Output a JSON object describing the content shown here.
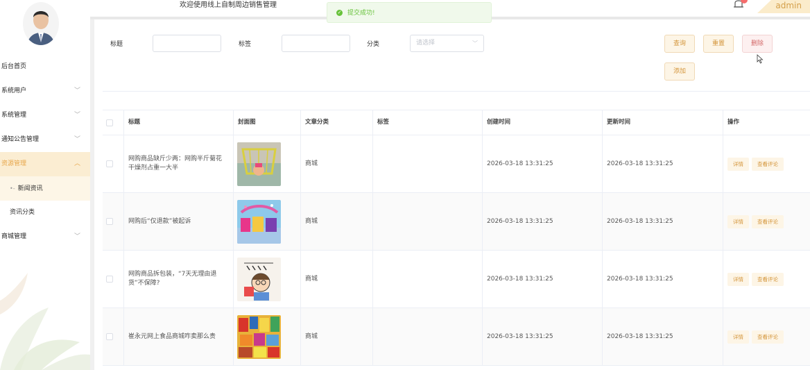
{
  "header": {
    "welcome": "欢迎使用线上自制周边销售管理",
    "username": "admin"
  },
  "toast": {
    "message": "提交成功!"
  },
  "sidebar": {
    "items": [
      {
        "label": "后台首页",
        "has_arrow": false
      },
      {
        "label": "系统用户",
        "has_arrow": true
      },
      {
        "label": "系统管理",
        "has_arrow": true
      },
      {
        "label": "通知公告管理",
        "has_arrow": true
      },
      {
        "label": "资源管理",
        "has_arrow": true,
        "expanded": true
      },
      {
        "label": "新闻资讯",
        "sub": true,
        "selected": true
      },
      {
        "label": "资讯分类",
        "sub": true
      },
      {
        "label": "商城管理",
        "has_arrow": true
      }
    ]
  },
  "search": {
    "title_label": "标题",
    "tag_label": "标签",
    "category_label": "分类",
    "category_placeholder": "请选择",
    "query_button": "查询",
    "reset_button": "重置",
    "delete_button": "删除",
    "add_button": "添加"
  },
  "table": {
    "columns": [
      "标题",
      "封面图",
      "文章分类",
      "标签",
      "创建时间",
      "更新时间",
      "操作"
    ],
    "rows": [
      {
        "title": "网购商品缺斤少两：网购半斤菊花 干燥剂占重一大半",
        "category": "商城",
        "tag": "",
        "created": "2026-03-18 13:31:25",
        "updated": "2026-03-18 13:31:25",
        "cover": "shopping-cart-image"
      },
      {
        "title": "网购后“仅退款”被起诉",
        "category": "商城",
        "tag": "",
        "created": "2026-03-18 13:31:25",
        "updated": "2026-03-18 13:31:25",
        "cover": "shopping-banner-image"
      },
      {
        "title": "网购商品拆包装，“7天无理由退货”不保障?",
        "category": "商城",
        "tag": "",
        "created": "2026-03-18 13:31:25",
        "updated": "2026-03-18 13:31:25",
        "cover": "cartoon-buyer-image"
      },
      {
        "title": "崔永元网上食品商城咋卖那么贵",
        "category": "商城",
        "tag": "",
        "created": "2026-03-18 13:31:25",
        "updated": "2026-03-18 13:31:25",
        "cover": "snack-food-image"
      }
    ],
    "detail_button": "详情",
    "comment_button": "查看评论"
  }
}
